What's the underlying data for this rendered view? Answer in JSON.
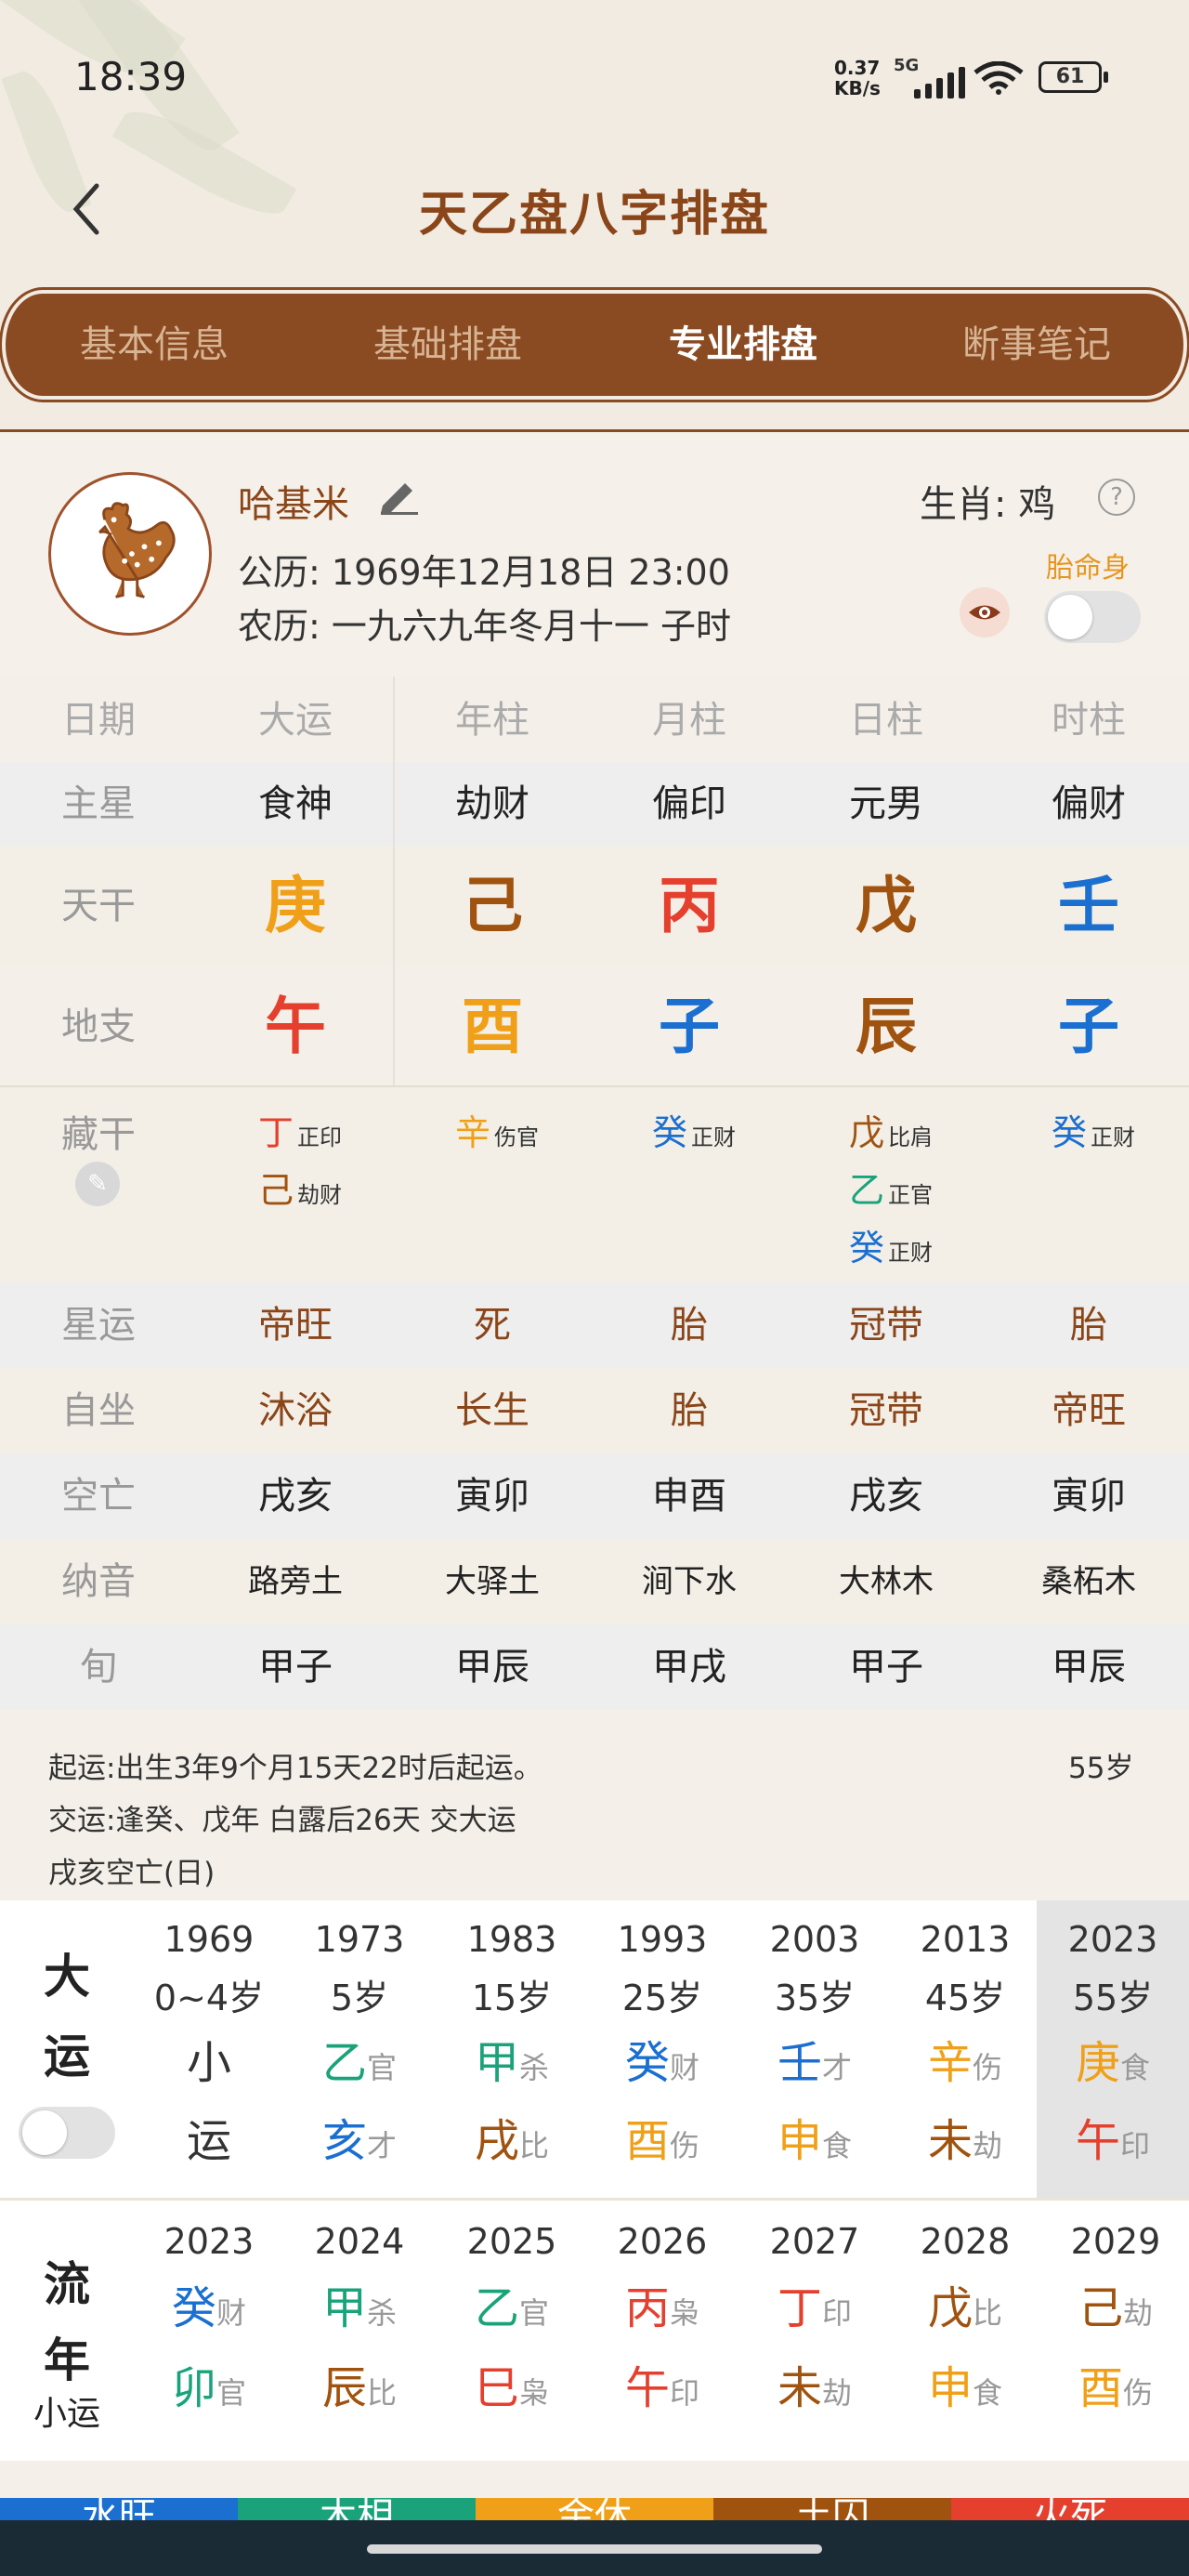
{
  "status": {
    "time": "18:39",
    "net_speed_value": "0.37",
    "net_speed_unit": "KB/s",
    "net_type": "5G",
    "battery": "61"
  },
  "header": {
    "title": "天乙盘八字排盘"
  },
  "tabs": [
    {
      "label": "基本信息",
      "active": false
    },
    {
      "label": "基础排盘",
      "active": false
    },
    {
      "label": "专业排盘",
      "active": true
    },
    {
      "label": "断事笔记",
      "active": false
    }
  ],
  "profile": {
    "name": "哈基米",
    "solar_label": "公历:",
    "solar_value": "1969年12月18日 23:00",
    "lunar_label": "农历:",
    "lunar_value": "一九六九年冬月十一 子时",
    "zodiac_label": "生肖:",
    "zodiac_value": "鸡",
    "help": "?",
    "toggle_label": "胎命身"
  },
  "grid": {
    "headers": [
      "日期",
      "大运",
      "年柱",
      "月柱",
      "日柱",
      "时柱"
    ],
    "main_star": {
      "label": "主星",
      "values": [
        "食神",
        "劫财",
        "偏印",
        "元男",
        "偏财"
      ]
    },
    "tiangan": {
      "label": "天干",
      "values": [
        "庚",
        "己",
        "丙",
        "戊",
        "壬"
      ],
      "elements": [
        "metal",
        "earth",
        "fire",
        "earth",
        "water"
      ]
    },
    "dizhi": {
      "label": "地支",
      "values": [
        "午",
        "酉",
        "子",
        "辰",
        "子"
      ],
      "elements": [
        "fire",
        "metal",
        "water",
        "earth",
        "water"
      ]
    },
    "canggan": {
      "label": "藏干",
      "cols": [
        [
          {
            "g": "丁",
            "s": "正印",
            "e": "fire"
          },
          {
            "g": "己",
            "s": "劫财",
            "e": "earth"
          }
        ],
        [
          {
            "g": "辛",
            "s": "伤官",
            "e": "metal"
          }
        ],
        [
          {
            "g": "癸",
            "s": "正财",
            "e": "water"
          }
        ],
        [
          {
            "g": "戊",
            "s": "比肩",
            "e": "earth"
          },
          {
            "g": "乙",
            "s": "正官",
            "e": "wood"
          },
          {
            "g": "癸",
            "s": "正财",
            "e": "water"
          }
        ],
        [
          {
            "g": "癸",
            "s": "正财",
            "e": "water"
          }
        ]
      ]
    },
    "xingyun": {
      "label": "星运",
      "values": [
        "帝旺",
        "死",
        "胎",
        "冠带",
        "胎"
      ]
    },
    "zizuo": {
      "label": "自坐",
      "values": [
        "沐浴",
        "长生",
        "胎",
        "冠带",
        "帝旺"
      ]
    },
    "kongwang": {
      "label": "空亡",
      "values": [
        "戌亥",
        "寅卯",
        "申酉",
        "戌亥",
        "寅卯"
      ]
    },
    "nayin": {
      "label": "纳音",
      "values": [
        "路旁土",
        "大驿土",
        "涧下水",
        "大林木",
        "桑柘木"
      ]
    },
    "xun": {
      "label": "旬",
      "values": [
        "甲子",
        "甲辰",
        "甲戌",
        "甲子",
        "甲辰"
      ]
    }
  },
  "info": {
    "line1": "起运:出生3年9个月15天22时后起运。",
    "age": "55岁",
    "line2": "交运:逢癸、戊年 白露后26天 交大运",
    "line3": "戌亥空亡(日)"
  },
  "dayun": {
    "label_top": "大",
    "label_bottom": "运",
    "cols": [
      {
        "year": "1969",
        "age": "0~4岁",
        "g": "小",
        "gs": "",
        "ge": "black",
        "z": "运",
        "zs": "",
        "ze": "black",
        "active": false
      },
      {
        "year": "1973",
        "age": "5岁",
        "g": "乙",
        "gs": "官",
        "ge": "wood",
        "z": "亥",
        "zs": "才",
        "ze": "water",
        "active": false
      },
      {
        "year": "1983",
        "age": "15岁",
        "g": "甲",
        "gs": "杀",
        "ge": "wood",
        "z": "戌",
        "zs": "比",
        "ze": "earth",
        "active": false
      },
      {
        "year": "1993",
        "age": "25岁",
        "g": "癸",
        "gs": "财",
        "ge": "water",
        "z": "酉",
        "zs": "伤",
        "ze": "metal",
        "active": false
      },
      {
        "year": "2003",
        "age": "35岁",
        "g": "壬",
        "gs": "才",
        "ge": "water",
        "z": "申",
        "zs": "食",
        "ze": "metal",
        "active": false
      },
      {
        "year": "2013",
        "age": "45岁",
        "g": "辛",
        "gs": "伤",
        "ge": "metal",
        "z": "未",
        "zs": "劫",
        "ze": "earth",
        "active": false
      },
      {
        "year": "2023",
        "age": "55岁",
        "g": "庚",
        "gs": "食",
        "ge": "metal",
        "z": "午",
        "zs": "印",
        "ze": "fire",
        "active": true
      }
    ]
  },
  "liunian": {
    "label_top": "流",
    "label_mid": "年",
    "label_bottom": "小运",
    "cols": [
      {
        "year": "2023",
        "g": "癸",
        "gs": "财",
        "ge": "water",
        "z": "卯",
        "zs": "官",
        "ze": "wood"
      },
      {
        "year": "2024",
        "g": "甲",
        "gs": "杀",
        "ge": "wood",
        "z": "辰",
        "zs": "比",
        "ze": "earth"
      },
      {
        "year": "2025",
        "g": "乙",
        "gs": "官",
        "ge": "wood",
        "z": "巳",
        "zs": "枭",
        "ze": "fire"
      },
      {
        "year": "2026",
        "g": "丙",
        "gs": "枭",
        "ge": "fire",
        "z": "午",
        "zs": "印",
        "ze": "fire"
      },
      {
        "year": "2027",
        "g": "丁",
        "gs": "印",
        "ge": "fire",
        "z": "未",
        "zs": "劫",
        "ze": "earth"
      },
      {
        "year": "2028",
        "g": "戊",
        "gs": "比",
        "ge": "earth",
        "z": "申",
        "zs": "食",
        "ze": "metal"
      },
      {
        "year": "2029",
        "g": "己",
        "gs": "劫",
        "ge": "earth",
        "z": "酉",
        "zs": "伤",
        "ze": "metal"
      }
    ]
  },
  "elements_strip": [
    {
      "label": "水旺",
      "color": "#1a6fd0"
    },
    {
      "label": "木相",
      "color": "#1aa37a"
    },
    {
      "label": "金休",
      "color": "#f0a018"
    },
    {
      "label": "土囚",
      "color": "#a0520f"
    },
    {
      "label": "火死",
      "color": "#e53f2e"
    }
  ],
  "colors": {
    "earth": "#a0520f",
    "fire": "#e53f2e",
    "water": "#1a6fd0",
    "wood": "#1aa37a",
    "metal": "#f0a018",
    "brand": "#8a4a22"
  }
}
